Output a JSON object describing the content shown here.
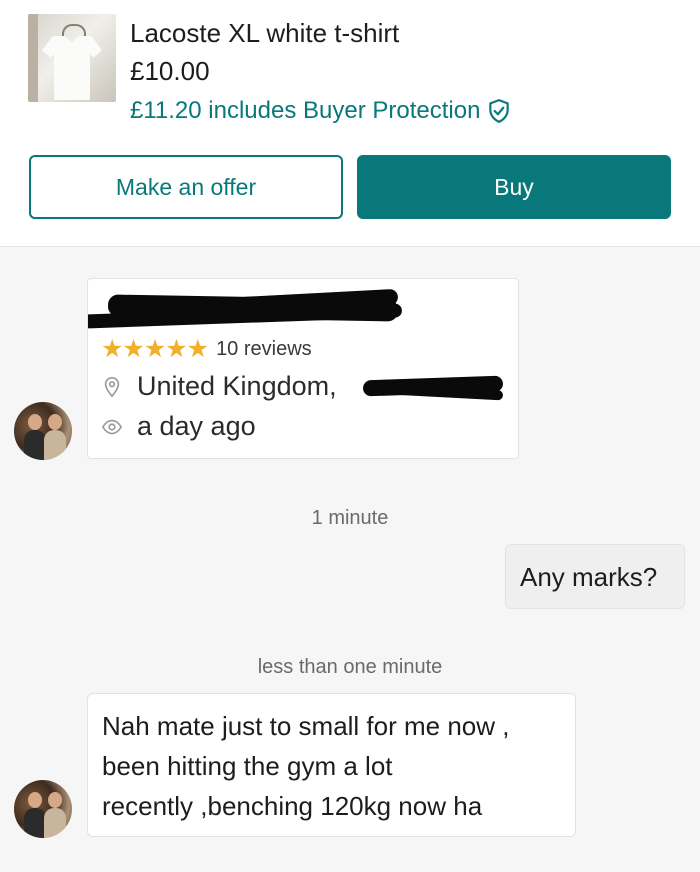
{
  "listing": {
    "title": "Lacoste XL white t-shirt",
    "price": "£10.00",
    "protection_text": "£11.20 includes Buyer Protection",
    "offer_label": "Make an offer",
    "buy_label": "Buy",
    "thumbnail": "white-tshirt-on-hanger"
  },
  "profile": {
    "rating_stars": "★★★★★",
    "reviews": "10 reviews",
    "location": "United Kingdom,",
    "last_seen": "a day ago",
    "location_icon": "location-pin-icon",
    "last_seen_icon": "eye-icon"
  },
  "chat": {
    "timestamp_1": "1 minute",
    "message_out": "Any marks?",
    "timestamp_2": "less than one minute",
    "message_in_lines": [
      "Nah mate just to small for me now ,",
      "been hitting the gym a lot",
      "recently ,benching 120kg now ha"
    ]
  },
  "colors": {
    "accent": "#09787a",
    "star": "#f1b02a",
    "background": "#f6f6f6"
  }
}
